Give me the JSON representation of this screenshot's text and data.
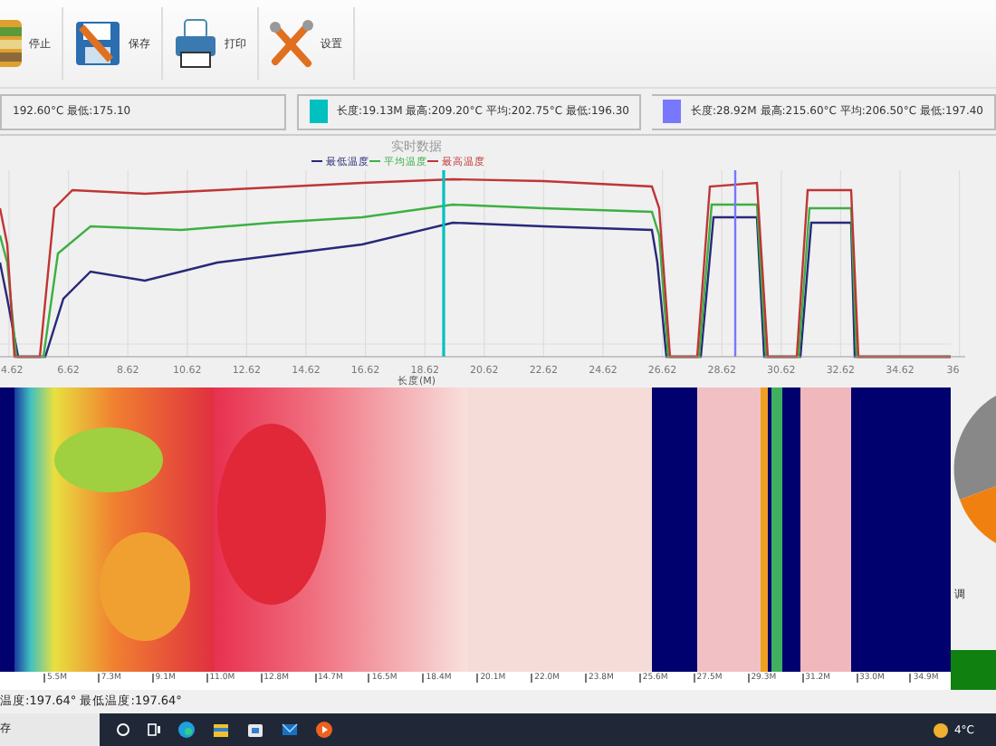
{
  "toolbar": {
    "buttons": [
      {
        "label": "停止",
        "kind": "stop"
      },
      {
        "label": "保存",
        "kind": "save"
      },
      {
        "label": "打印",
        "kind": "print"
      },
      {
        "label": "设置",
        "kind": "settings"
      }
    ]
  },
  "cursor_readouts": [
    {
      "text": "192.60°C 最低:175.10"
    },
    {
      "text": "长度:19.13M 最高:209.20°C 平均:202.75°C 最低:196.30",
      "color": "#00c0c0"
    },
    {
      "text": "长度:28.92M 最高:215.60°C 平均:206.50°C 最低:197.40",
      "color": "#7878ff"
    }
  ],
  "chart": {
    "title": "实时数据",
    "xlabel": "长度(M)",
    "legend": [
      {
        "label": "最低温度",
        "color": "#28287a"
      },
      {
        "label": "平均温度",
        "color": "#3cb043"
      },
      {
        "label": "最高温度",
        "color": "#c03535"
      }
    ],
    "xticks": [
      "4.62",
      "6.62",
      "8.62",
      "10.62",
      "12.62",
      "14.62",
      "16.62",
      "18.62",
      "20.62",
      "22.62",
      "24.62",
      "26.62",
      "28.62",
      "30.62",
      "32.62",
      "34.62",
      "36"
    ]
  },
  "heatmap": {
    "kind": "picture",
    "ticks": [
      "5.5M",
      "7.3M",
      "9.1M",
      "11.0M",
      "12.8M",
      "14.7M",
      "16.5M",
      "18.4M",
      "20.1M",
      "22.0M",
      "23.8M",
      "25.6M",
      "27.5M",
      "29.3M",
      "31.2M",
      "33.0M",
      "34.9M"
    ]
  },
  "side_panel": {
    "label": "调"
  },
  "status_text": "温度:197.64° 最低温度:197.64°",
  "taskbar": {
    "left_text": "存",
    "weather": "4°C"
  }
}
